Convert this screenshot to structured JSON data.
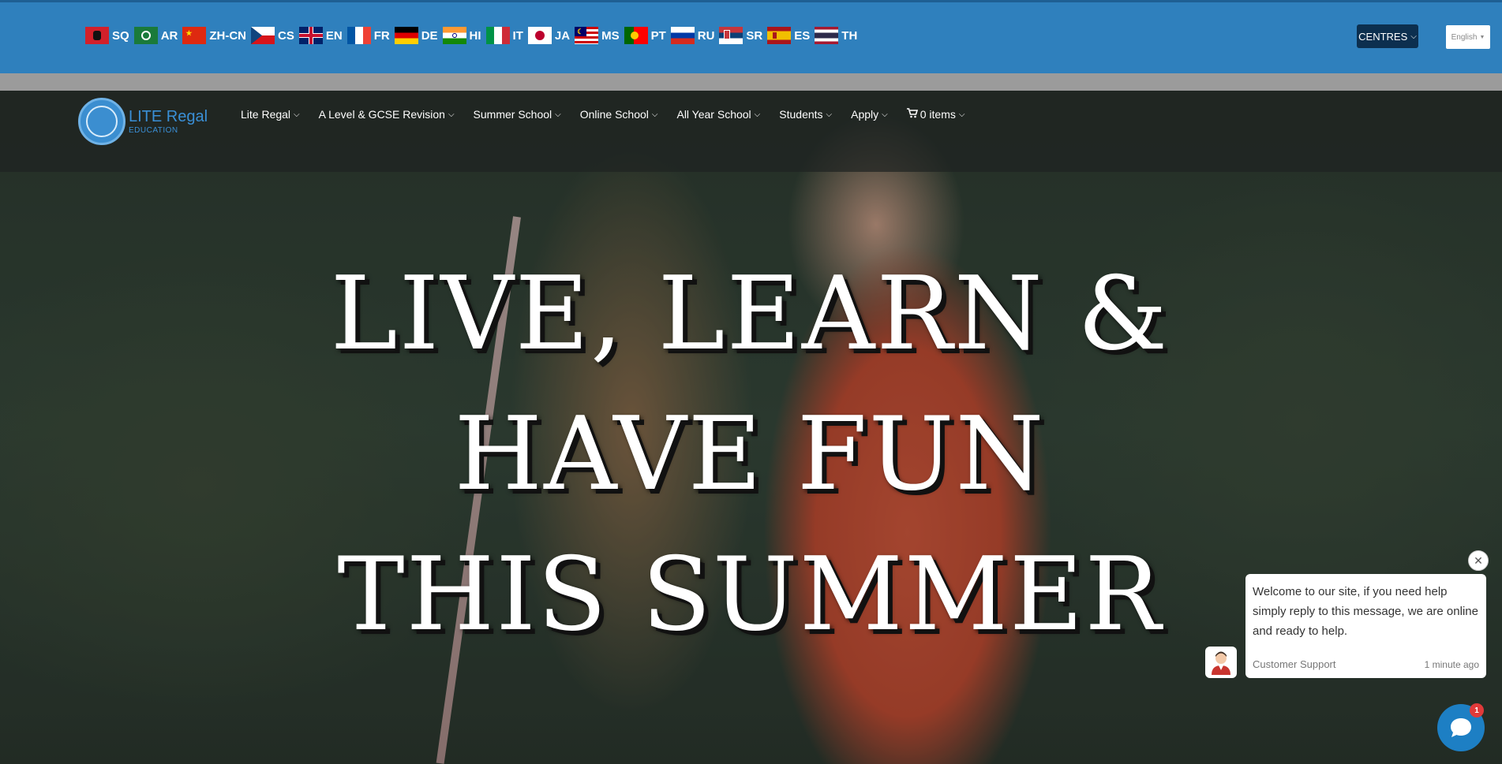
{
  "languages": [
    {
      "code": "SQ"
    },
    {
      "code": "AR"
    },
    {
      "code": "ZH-CN"
    },
    {
      "code": "CS"
    },
    {
      "code": "EN"
    },
    {
      "code": "FR"
    },
    {
      "code": "DE"
    },
    {
      "code": "HI"
    },
    {
      "code": "IT"
    },
    {
      "code": "JA"
    },
    {
      "code": "MS"
    },
    {
      "code": "PT"
    },
    {
      "code": "RU"
    },
    {
      "code": "SR"
    },
    {
      "code": "ES"
    },
    {
      "code": "TH"
    }
  ],
  "topbar": {
    "centres_label": "CENTRES",
    "language_select_value": "English"
  },
  "logo": {
    "title": "LITE Regal",
    "subtitle": "EDUCATION"
  },
  "nav": {
    "items": [
      {
        "label": "Lite Regal"
      },
      {
        "label": "A Level & GCSE Revision"
      },
      {
        "label": "Summer School"
      },
      {
        "label": "Online School"
      },
      {
        "label": "All Year School"
      },
      {
        "label": "Students"
      },
      {
        "label": "Apply"
      }
    ],
    "cart_label": "0 items"
  },
  "hero": {
    "line1": "LIVE, LEARN &",
    "line2": "HAVE FUN",
    "line3": "THIS SUMMER"
  },
  "chat": {
    "message": "Welcome to our site, if you need help simply reply to this message, we are online and ready to help.",
    "agent": "Customer Support",
    "time": "1 minute ago",
    "badge_count": "1"
  },
  "colors": {
    "topbar": "#2f80bd",
    "centres_button": "#0c2f4f",
    "logo": "#3a8fd6",
    "chat_launcher": "#1d7fc4",
    "badge": "#e13a3a"
  }
}
